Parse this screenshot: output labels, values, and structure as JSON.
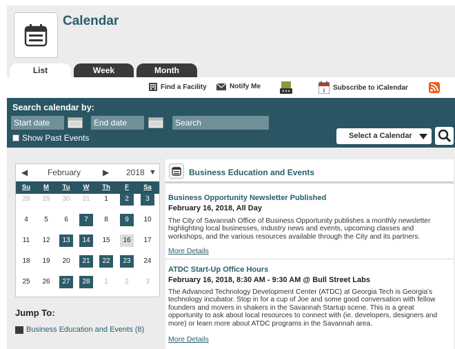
{
  "header": {
    "title": "Calendar"
  },
  "tabs": [
    {
      "label": "List",
      "active": true
    },
    {
      "label": "Week",
      "active": false
    },
    {
      "label": "Month",
      "active": false
    }
  ],
  "toolbar": {
    "find_facility": "Find a Facility",
    "notify_me": "Notify Me",
    "subscribe": "Subscribe to iCalendar",
    "rss_color": "#e8601c"
  },
  "search": {
    "title": "Search calendar by:",
    "start_date_placeholder": "Start date",
    "end_date_placeholder": "End date",
    "search_placeholder": "Search",
    "show_past": "Show Past Events",
    "select_calendar": "Select a Calendar"
  },
  "minical": {
    "month": "February",
    "year": "2018",
    "weekdays": [
      "Su",
      "M",
      "Tu",
      "W",
      "Th",
      "F",
      "Sa"
    ],
    "weeks": [
      [
        {
          "d": "28",
          "s": "other"
        },
        {
          "d": "29",
          "s": "other"
        },
        {
          "d": "30",
          "s": "other"
        },
        {
          "d": "31",
          "s": "other"
        },
        {
          "d": "1",
          "s": ""
        },
        {
          "d": "2",
          "s": "event"
        },
        {
          "d": "3",
          "s": "event"
        }
      ],
      [
        {
          "d": "4",
          "s": ""
        },
        {
          "d": "5",
          "s": ""
        },
        {
          "d": "6",
          "s": ""
        },
        {
          "d": "7",
          "s": "event"
        },
        {
          "d": "8",
          "s": ""
        },
        {
          "d": "9",
          "s": "event"
        },
        {
          "d": "10",
          "s": ""
        }
      ],
      [
        {
          "d": "11",
          "s": ""
        },
        {
          "d": "12",
          "s": ""
        },
        {
          "d": "13",
          "s": "event"
        },
        {
          "d": "14",
          "s": "event"
        },
        {
          "d": "15",
          "s": ""
        },
        {
          "d": "16",
          "s": "today"
        },
        {
          "d": "17",
          "s": ""
        }
      ],
      [
        {
          "d": "18",
          "s": ""
        },
        {
          "d": "19",
          "s": ""
        },
        {
          "d": "20",
          "s": ""
        },
        {
          "d": "21",
          "s": "event"
        },
        {
          "d": "22",
          "s": "event"
        },
        {
          "d": "23",
          "s": "event"
        },
        {
          "d": "24",
          "s": ""
        }
      ],
      [
        {
          "d": "25",
          "s": ""
        },
        {
          "d": "26",
          "s": ""
        },
        {
          "d": "27",
          "s": "event"
        },
        {
          "d": "28",
          "s": "event"
        },
        {
          "d": "1",
          "s": "other"
        },
        {
          "d": "2",
          "s": "other"
        },
        {
          "d": "3",
          "s": "other"
        }
      ]
    ]
  },
  "jump": {
    "title": "Jump To:",
    "items": [
      {
        "label": "Business Education and Events (8)"
      }
    ]
  },
  "events": {
    "category": "Business Education and Events",
    "items": [
      {
        "title": "Business Opportunity Newsletter Published",
        "date": "February 16, 2018, All Day",
        "description": "The City of Savannah Office of Business Opportunity publishes a monthly newsletter highlighting local businesses, industry news and events, upcoming classes and workshops, and the various resources available through the City and its partners.",
        "more": "More Details"
      },
      {
        "title": "ATDC Start-Up Office Hours",
        "date": "February 16, 2018, 8:30 AM - 9:30 AM @ Bull Street Labs",
        "description": "The Advanced Technology Development Center (ATDC) at Georgia Tech is Georgia's technology incubator. Stop in for a cup of Joe and some good conversation with fellow founders and movers in shakers in the Savannah Startup scene. This is a great opportunity to ask about local resources to connect with (ie. developers, designers and more) or learn more about ATDC programs in the Savannah area.",
        "more": "More Details"
      }
    ]
  }
}
